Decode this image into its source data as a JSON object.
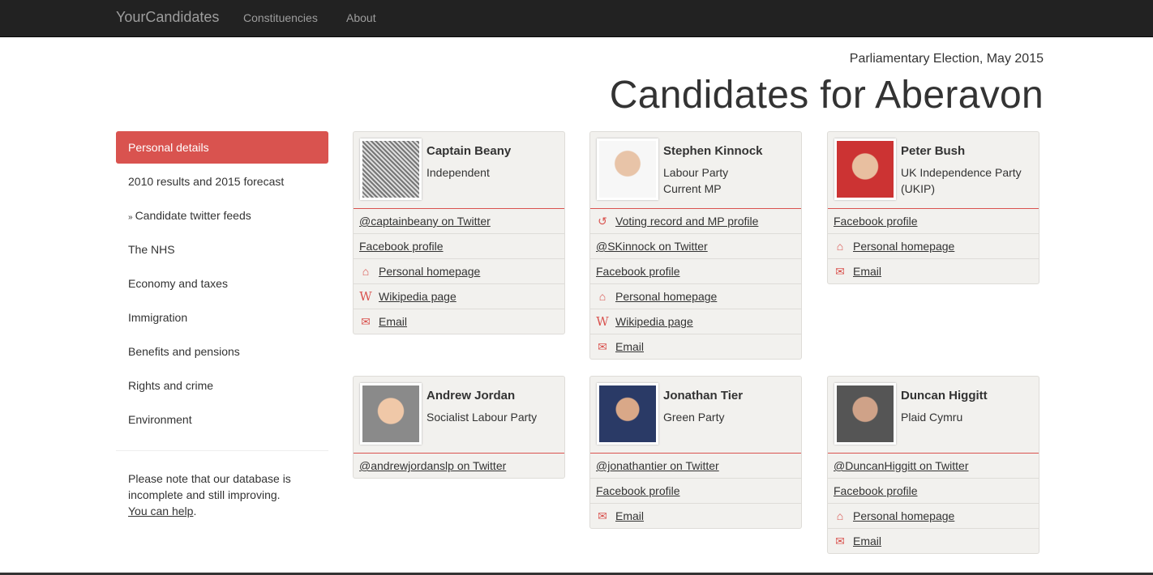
{
  "nav": {
    "brand": "YourCandidates",
    "links": [
      "Constituencies",
      "About"
    ]
  },
  "header": {
    "subtitle": "Parliamentary Election, May 2015",
    "title": "Candidates for Aberavon"
  },
  "sidebar": {
    "items": [
      "Personal details",
      "2010 results and 2015 forecast",
      "Candidate twitter feeds",
      "The NHS",
      "Economy and taxes",
      "Immigration",
      "Benefits and pensions",
      "Rights and crime",
      "Environment"
    ],
    "note": {
      "line1": "Please note that our database is",
      "line2": "incomplete and still improving.",
      "help_link": "You can help",
      "period": "."
    }
  },
  "candidates": [
    {
      "name": "Captain Beany",
      "party": "Independent",
      "extra": "",
      "links": [
        {
          "icon": "",
          "text": "@captainbeany on Twitter"
        },
        {
          "icon": "",
          "text": "Facebook profile"
        },
        {
          "icon": "home-icon",
          "text": "Personal homepage"
        },
        {
          "icon": "wikipedia-icon",
          "text": "Wikipedia page"
        },
        {
          "icon": "envelope-icon",
          "text": "Email"
        }
      ]
    },
    {
      "name": "Stephen Kinnock",
      "party": "Labour Party",
      "extra": "Current MP",
      "links": [
        {
          "icon": "history-icon",
          "text": "Voting record and MP profile"
        },
        {
          "icon": "",
          "text": "@SKinnock on Twitter"
        },
        {
          "icon": "",
          "text": "Facebook profile"
        },
        {
          "icon": "home-icon",
          "text": "Personal homepage"
        },
        {
          "icon": "wikipedia-icon",
          "text": "Wikipedia page"
        },
        {
          "icon": "envelope-icon",
          "text": "Email"
        }
      ]
    },
    {
      "name": "Peter Bush",
      "party": "UK Independence Party (UKIP)",
      "extra": "",
      "links": [
        {
          "icon": "",
          "text": "Facebook profile"
        },
        {
          "icon": "home-icon",
          "text": "Personal homepage"
        },
        {
          "icon": "envelope-icon",
          "text": "Email"
        }
      ]
    },
    {
      "name": "Andrew Jordan",
      "party": "Socialist Labour Party",
      "extra": "",
      "links": [
        {
          "icon": "",
          "text": "@andrewjordanslp on Twitter"
        }
      ]
    },
    {
      "name": "Jonathan Tier",
      "party": "Green Party",
      "extra": "",
      "links": [
        {
          "icon": "",
          "text": "@jonathantier on Twitter"
        },
        {
          "icon": "",
          "text": "Facebook profile"
        },
        {
          "icon": "envelope-icon",
          "text": "Email"
        }
      ]
    },
    {
      "name": "Duncan Higgitt",
      "party": "Plaid Cymru",
      "extra": "",
      "links": [
        {
          "icon": "",
          "text": "@DuncanHiggitt on Twitter"
        },
        {
          "icon": "",
          "text": "Facebook profile"
        },
        {
          "icon": "home-icon",
          "text": "Personal homepage"
        },
        {
          "icon": "envelope-icon",
          "text": "Email"
        }
      ]
    }
  ],
  "colors": {
    "accent": "#d9534f",
    "navbar": "#222222",
    "card": "#f2f1ee"
  }
}
